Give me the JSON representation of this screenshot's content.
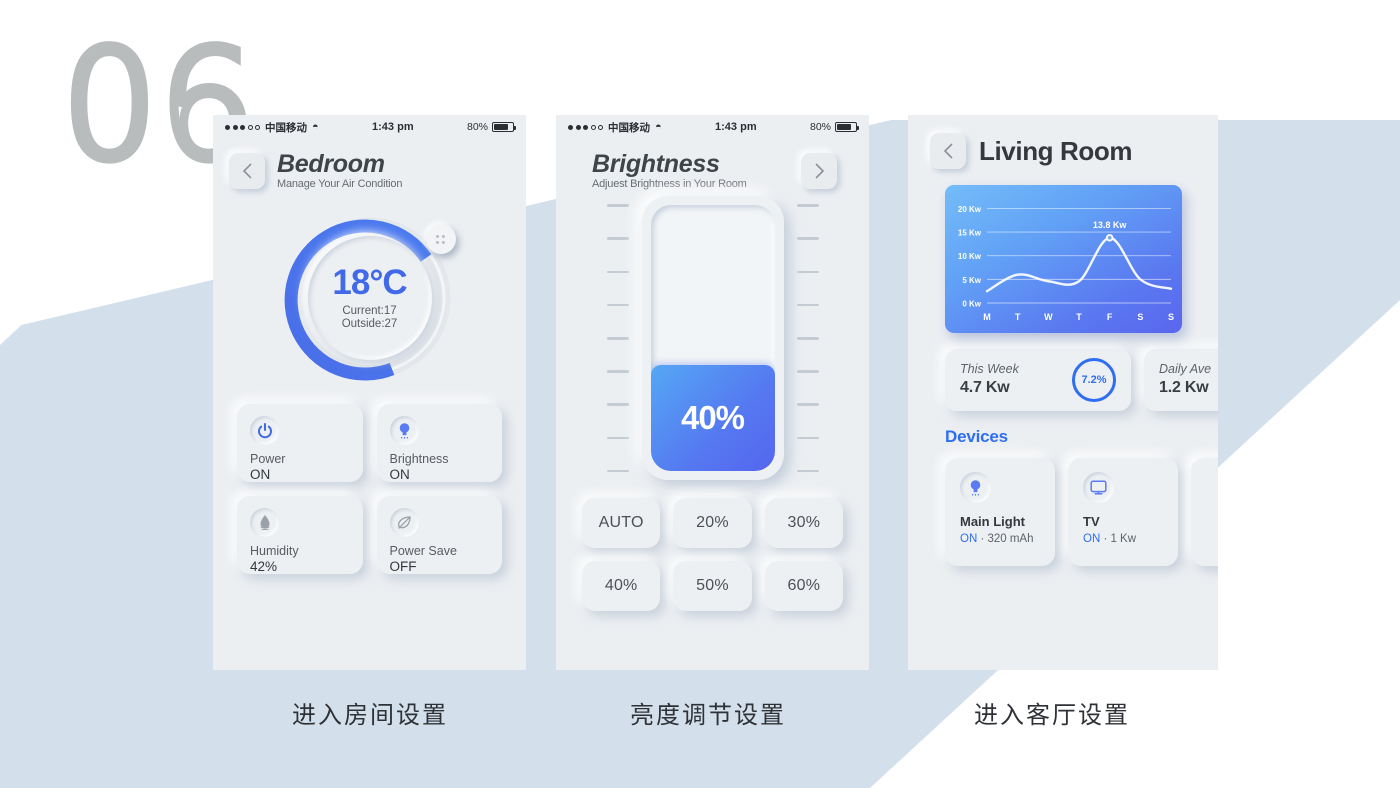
{
  "slide": {
    "number": "06"
  },
  "colors": {
    "accent_blue": "#2f6ef0",
    "dial_blue": "#4169e8",
    "band_blue": "#d3e0ec",
    "phone_bg": "#eceff2"
  },
  "statusbar": {
    "carrier": "中国移动",
    "time": "1:43 pm",
    "battery": "80%",
    "wifi_icon": "wifi-icon"
  },
  "phone1": {
    "back_icon": "chevron-left-icon",
    "title": "Bedroom",
    "subtitle": "Manage Your Air Condition",
    "dial": {
      "temperature": "18°C",
      "current": "Current:17",
      "outside": "Outside:27",
      "knob_icon": "dial-knob-icon",
      "arc_percent": 75
    },
    "cards": [
      {
        "icon": "power-icon",
        "label": "Power",
        "value": "ON",
        "accent": true
      },
      {
        "icon": "bulb-icon",
        "label": "Brightness",
        "value": "ON",
        "accent": true
      },
      {
        "icon": "droplet-icon",
        "label": "Humidity",
        "value": "42%",
        "accent": false
      },
      {
        "icon": "leaf-icon",
        "label": "Power Save",
        "value": "OFF",
        "accent": false
      }
    ]
  },
  "phone2": {
    "forward_icon": "chevron-right-icon",
    "title": "Brightness",
    "subtitle": "Adjuest Brightness in Your Room",
    "slider": {
      "value_label": "40%",
      "percent": 40,
      "tick_count": 9
    },
    "presets": [
      "AUTO",
      "20%",
      "30%",
      "40%",
      "50%",
      "60%"
    ]
  },
  "phone3": {
    "back_icon": "chevron-left-icon",
    "title": "Living Room",
    "stats": [
      {
        "label": "This Week",
        "value": "4.7 Kw",
        "badge": "7.2%"
      },
      {
        "label": "Daily Ave",
        "value": "1.2 Kw",
        "badge": ""
      }
    ],
    "devices_heading": "Devices",
    "devices": [
      {
        "icon": "bulb-icon",
        "name": "Main Light",
        "status": "ON",
        "detail": " · 320 mAh"
      },
      {
        "icon": "tv-icon",
        "name": "TV",
        "status": "ON",
        "detail": " · 1 Kw"
      }
    ]
  },
  "chart_data": {
    "type": "line",
    "title": "",
    "xlabel": "",
    "ylabel": "Kw",
    "categories": [
      "M",
      "T",
      "W",
      "T",
      "F",
      "S",
      "S"
    ],
    "values": [
      2.5,
      6.0,
      4.6,
      4.6,
      13.8,
      5.0,
      3.0
    ],
    "ytick_labels": [
      "0 Kw",
      "5 Kw",
      "10 Kw",
      "15 Kw",
      "20 Kw"
    ],
    "yticks": [
      0,
      5,
      10,
      15,
      20
    ],
    "ylim": [
      0,
      22
    ],
    "grid": true,
    "legend": "none",
    "annotations": [
      {
        "text": "13.8 Kw",
        "x_category": "F",
        "y": 13.8,
        "marker": "circle"
      }
    ]
  },
  "captions": {
    "c1": "进入房间设置",
    "c2": "亮度调节设置",
    "c3": "进入客厅设置"
  }
}
